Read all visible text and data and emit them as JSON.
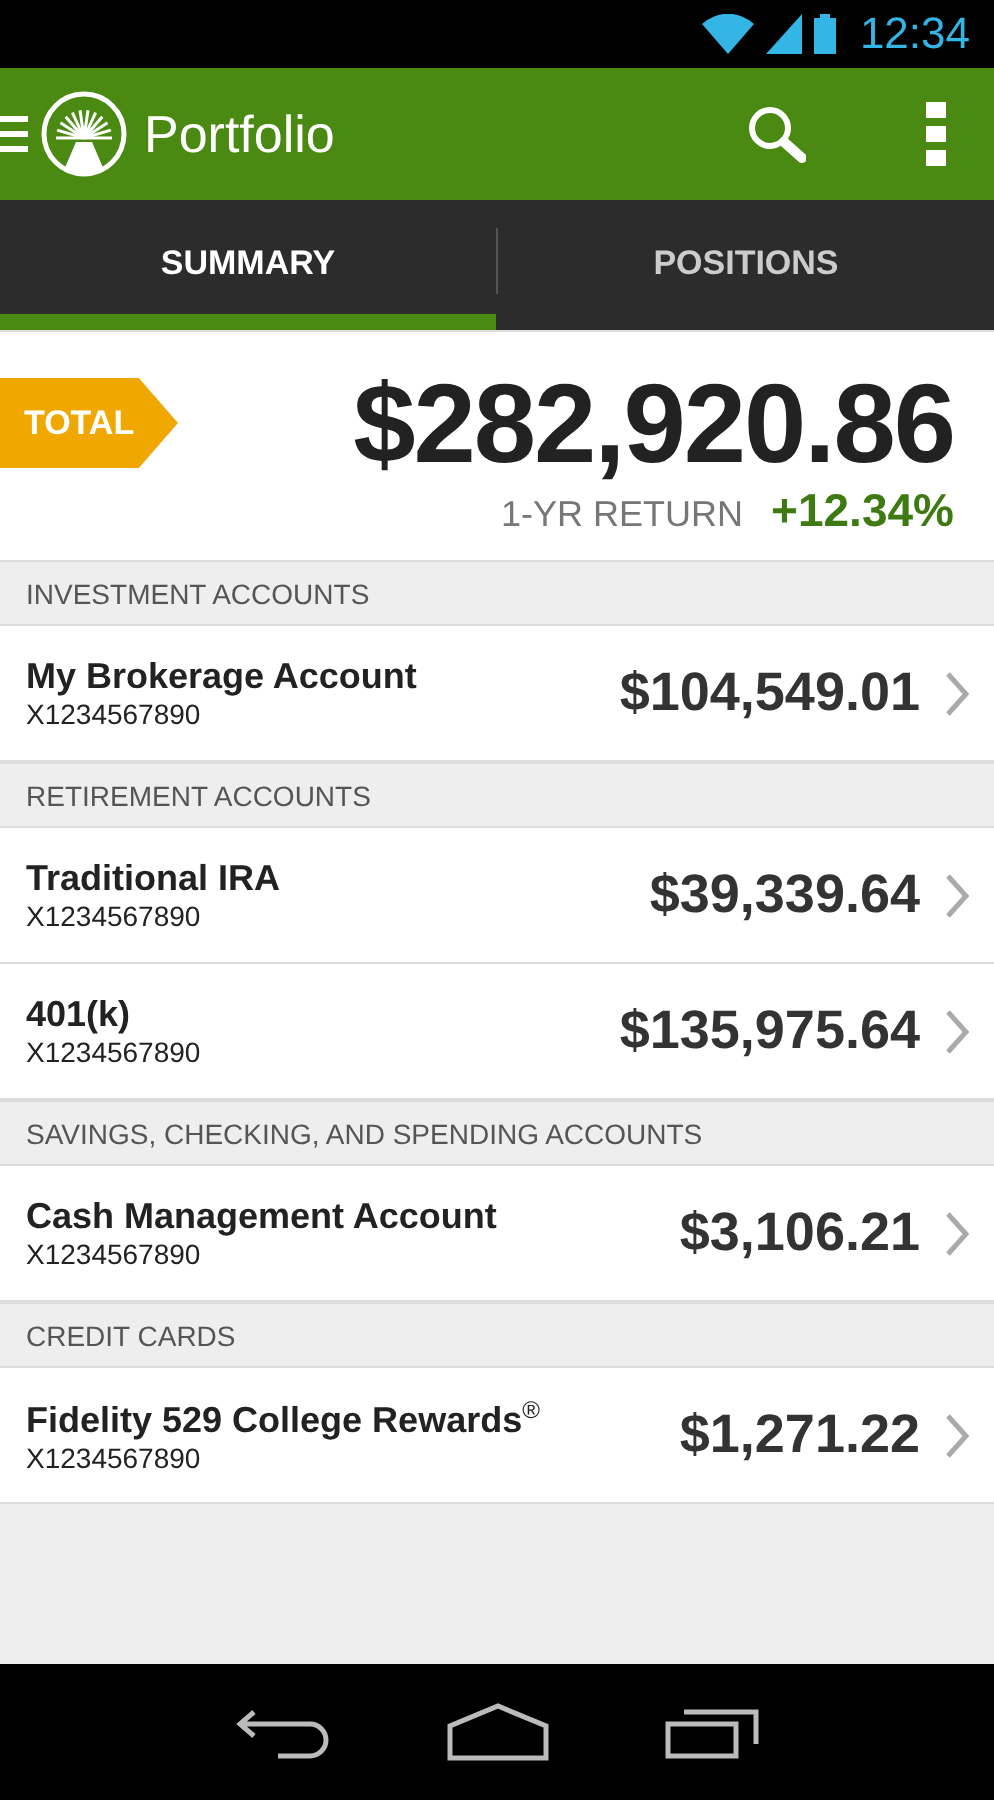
{
  "status_bar": {
    "time": "12:34"
  },
  "app_bar": {
    "title": "Portfolio"
  },
  "tabs": [
    {
      "label": "SUMMARY",
      "selected": true
    },
    {
      "label": "POSITIONS",
      "selected": false
    }
  ],
  "summary": {
    "badge": "TOTAL",
    "total": "$282,920.86",
    "return_label": "1-YR RETURN",
    "return_value": "+12.34%"
  },
  "sections": [
    {
      "title": "INVESTMENT ACCOUNTS",
      "accounts": [
        {
          "name": "My Brokerage Account",
          "number": "X1234567890",
          "balance": "$104,549.01"
        }
      ]
    },
    {
      "title": "RETIREMENT ACCOUNTS",
      "accounts": [
        {
          "name": "Traditional IRA",
          "number": "X1234567890",
          "balance": "$39,339.64"
        },
        {
          "name": "401(k)",
          "number": "X1234567890",
          "balance": "$135,975.64"
        }
      ]
    },
    {
      "title": "SAVINGS, CHECKING, AND SPENDING ACCOUNTS",
      "accounts": [
        {
          "name": "Cash Management Account",
          "number": "X1234567890",
          "balance": "$3,106.21"
        }
      ]
    },
    {
      "title": "CREDIT CARDS",
      "accounts": [
        {
          "name": "Fidelity 529 College Rewards$^{®}$",
          "number": "X1234567890",
          "balance": "$1,271.22"
        }
      ]
    }
  ]
}
